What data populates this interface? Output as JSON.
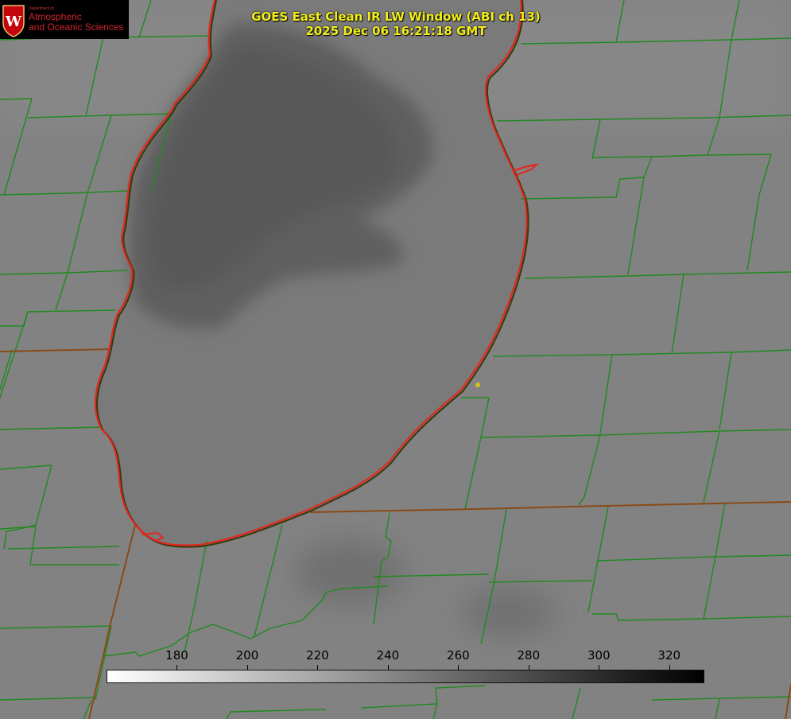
{
  "header": {
    "logo_dept": "Department of",
    "logo_line1": "Atmospheric",
    "logo_line2": "and Oceanic Sciences",
    "logo_crest_letter": "W",
    "title_line1": "GOES East Clean IR LW Window (ABI ch 13)",
    "title_line2": "2025 Dec 06 16:21:18 GMT"
  },
  "colorbar": {
    "min": 160,
    "max": 330,
    "ticks": [
      "180",
      "200",
      "220",
      "240",
      "260",
      "280",
      "300",
      "320"
    ],
    "gradient_start": "#ffffff",
    "gradient_end": "#000000"
  },
  "colors": {
    "county_border": "#1f8a1f",
    "coastline": "#e8241b",
    "state_border": "#8a4a16",
    "title_text": "#f2ee1a",
    "marker": "#d9c21a",
    "cloud_deep": "#5d5d5d",
    "background_gray": "#7f7f7f"
  },
  "marker": {
    "icon": "station-dot-icon"
  }
}
